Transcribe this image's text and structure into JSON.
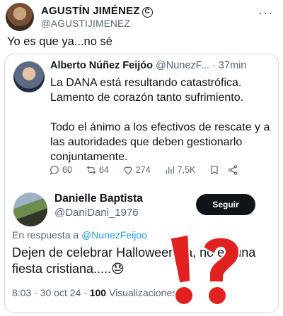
{
  "outer": {
    "name": "AGUSTÍN JIMÉNEZ",
    "copyright_symbol": "C",
    "handle": "@AGUSTIJIMENEZ",
    "more": "···",
    "text": "Yo es que ya...no sé"
  },
  "quoted": {
    "name": "Alberto Núñez Feijóo",
    "handle_time": "@NunezF... · 37min",
    "paragraph1": "La DANA está resultando catastrófica. Lamento de corazón tanto sufrimiento.",
    "paragraph2": "Todo el ánimo a los efectivos de rescate y a las autoridades que deben gestionarlo conjuntamente.",
    "actions": {
      "replies": "60",
      "reposts": "64",
      "likes": "274",
      "views": "7,5K"
    }
  },
  "reply": {
    "name": "Danielle Baptista",
    "handle": "@DaniDani_1976",
    "follow_label": "Seguir",
    "reply_prefix": "En respuesta a",
    "reply_mention": "@NunezFeijoo",
    "text": "Dejen de celebrar Halloween ya, no es una fiesta cristiana.....😓",
    "time_date": "8:03 · 30 oct 24 · ",
    "views_count": "100",
    "views_label": " Visualizaciones"
  },
  "colors": {
    "accent": "#1d9bf0",
    "overlay_red": "#e1211f",
    "text_secondary": "#536471"
  }
}
